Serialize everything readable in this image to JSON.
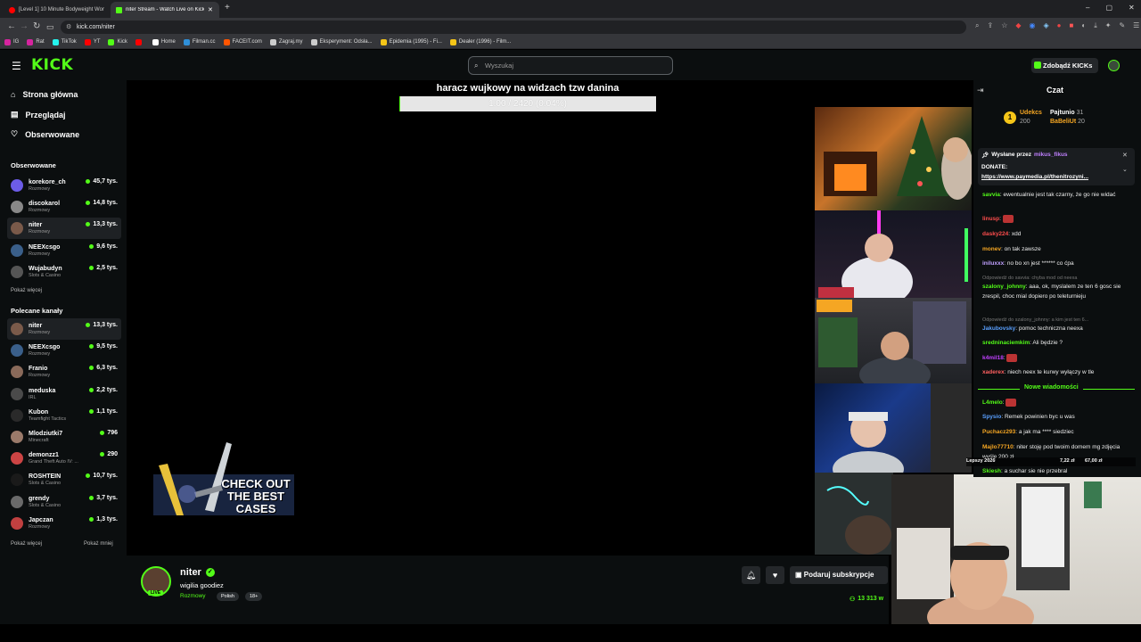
{
  "browser": {
    "tabs": [
      {
        "title": "[Level 1] 10 Minute Bodyweight Wor",
        "color": "#ff0000"
      },
      {
        "title": "niter Stream - Watch Live on Kick",
        "color": "#53fc18"
      }
    ],
    "new_tab": "+",
    "url": "kick.com/niter",
    "bookmarks": [
      {
        "label": "IG",
        "color": "#d6249f"
      },
      {
        "label": "Rat",
        "color": "#d6249f"
      },
      {
        "label": "TikTok",
        "color": "#25f4ee"
      },
      {
        "label": "YT",
        "color": "#ff0000"
      },
      {
        "label": "Kick",
        "color": "#53fc18"
      },
      {
        "label": "",
        "color": "#ff0000"
      },
      {
        "label": "Home",
        "color": "#ffffff"
      },
      {
        "label": "Filman.cc",
        "color": "#2f8fd8"
      },
      {
        "label": "FACEIT.com",
        "color": "#ff5500"
      },
      {
        "label": "Zagraj.my",
        "color": "#cccccc"
      },
      {
        "label": "Eksperyment: Odsła...",
        "color": "#cccccc"
      },
      {
        "label": "Epidemia (1995) - Fi...",
        "color": "#f5c518"
      },
      {
        "label": "Dealer (1996) - Film...",
        "color": "#f5c518"
      }
    ],
    "window_controls": [
      "–",
      "▢",
      "✕"
    ]
  },
  "header": {
    "logo": "KICK",
    "search_placeholder": "Wyszukaj",
    "kicks_button": "Zdobądź KICKs"
  },
  "sidebar": {
    "nav": [
      {
        "label": "Strona główna",
        "icon": "home-icon"
      },
      {
        "label": "Przeglądaj",
        "icon": "browse-icon"
      },
      {
        "label": "Obserwowane",
        "icon": "heart-icon"
      }
    ],
    "followed_title": "Obserwowane",
    "followed": [
      {
        "name": "korekore_ch",
        "category": "Rozmowy",
        "viewers": "45,7 tys.",
        "avatar": "#6c5ce7"
      },
      {
        "name": "discokarol",
        "category": "Rozmowy",
        "viewers": "14,8 tys.",
        "avatar": "#888888"
      },
      {
        "name": "niter",
        "category": "Rozmowy",
        "viewers": "13,3 tys.",
        "avatar": "#7a5a4a"
      },
      {
        "name": "NEEXcsgo",
        "category": "Rozmowy",
        "viewers": "9,6 tys.",
        "avatar": "#3a5f8a"
      },
      {
        "name": "Wujabudyn",
        "category": "Slots & Casino",
        "viewers": "2,5 tys.",
        "avatar": "#555555"
      }
    ],
    "show_more": "Pokaż więcej",
    "recommended_title": "Polecane kanały",
    "recommended": [
      {
        "name": "niter",
        "category": "Rozmowy",
        "viewers": "13,3 tys.",
        "avatar": "#7a5a4a"
      },
      {
        "name": "NEEXcsgo",
        "category": "Rozmowy",
        "viewers": "9,5 tys.",
        "avatar": "#3a5f8a"
      },
      {
        "name": "Franio",
        "category": "Rozmowy",
        "viewers": "6,3 tys.",
        "avatar": "#8a6a5a"
      },
      {
        "name": "meduska",
        "category": "IRL",
        "viewers": "2,2 tys.",
        "avatar": "#4a4a4a"
      },
      {
        "name": "Kubon",
        "category": "Teamfight Tactics",
        "viewers": "1,1 tys.",
        "avatar": "#2a2a2a"
      },
      {
        "name": "Mlodziutki7",
        "category": "Minecraft",
        "viewers": "796",
        "avatar": "#9a7a6a"
      },
      {
        "name": "demonzz1",
        "category": "Grand Theft Auto IV: ...",
        "viewers": "290",
        "avatar": "#cc4444"
      },
      {
        "name": "ROSHTEIN",
        "category": "Slots & Casino",
        "viewers": "10,7 tys.",
        "avatar": "#1a1a1a"
      },
      {
        "name": "grendy",
        "category": "Slots & Casino",
        "viewers": "3,7 tys.",
        "avatar": "#6a6a6a"
      },
      {
        "name": "Japczan",
        "category": "Rozmowy",
        "viewers": "1,3 tys.",
        "avatar": "#c04040"
      }
    ],
    "show_more2": "Pokaż więcej",
    "show_less": "Pokaż mniej"
  },
  "stream": {
    "overlay_title": "haracz wujkowy na widzach tzw danina",
    "goal_text": "1.00 / 2420 (0.04%)",
    "goal_progress": 0.0004,
    "promo": "CHECK OUT THE BEST CASES",
    "streamer": "niter",
    "stream_title": "wigilia goodiez",
    "category": "Rozmowy",
    "tags": [
      "Polish",
      "18+"
    ],
    "live_badge": "LIVE",
    "subscribe": "Podaruj subskrypcje",
    "viewers": "13 313 w"
  },
  "chat": {
    "title": "Czat",
    "top_gifters": [
      {
        "name": "Udekcs",
        "amount": "200",
        "color": "#f5a623"
      },
      {
        "name": "Pajtunio",
        "amount": "31",
        "color": "#ffffff"
      },
      {
        "name": "BaBeliUt",
        "amount": "20",
        "color": "#f5a623"
      }
    ],
    "pinned_by_label": "Wysłane przez",
    "pinned_user": "mikus_fikus",
    "pinned_text": "DONATE:",
    "pinned_link": "https://www.paymedia.pl/thenitrozyni...",
    "messages": [
      {
        "user": "savvia",
        "text": "ewentualnie jest tak czarny, że go nie widać",
        "color": "#53fc18"
      },
      {
        "user": "linusp",
        "text": "",
        "color": "#ff4d4d"
      },
      {
        "user": "dasky224",
        "text": "xdd",
        "color": "#ff4d4d"
      },
      {
        "user": "monev",
        "text": "on tak zawsze",
        "color": "#f5a623"
      },
      {
        "user": "iniluxxx",
        "text": "no bo xn jest ****** co ćpa",
        "color": "#c0a0ff"
      },
      {
        "reply": "Odpowiedź do savvia: chyba mod od neexa"
      },
      {
        "user": "szalony_johnny",
        "text": "aaa, ok, myslalem ze ten 6 gosc sie zrespil, choc mial dopiero po teleturnieju",
        "color": "#53fc18"
      },
      {
        "reply": "Odpowiedź do szalony_johnny: a kim jest ten 6..."
      },
      {
        "user": "Jakubovsky",
        "text": "pomoc techniczna neexa",
        "color": "#5aa0ff"
      },
      {
        "user": "sredninaciemkim",
        "text": "Ali będzie ?",
        "color": "#53fc18"
      },
      {
        "user": "k4mil18",
        "text": "",
        "color": "#c040ff"
      },
      {
        "user": "xaderex",
        "text": "niech neex te kurwy wyłączy w tle",
        "color": "#ff6060"
      }
    ],
    "new_messages": "Nowe wiadomości",
    "messages2": [
      {
        "user": "L4melo",
        "text": "",
        "color": "#53fc18"
      },
      {
        "user": "Spysio",
        "text": "Remek powinien byc u was",
        "color": "#5aa0ff"
      },
      {
        "user": "Puchacz293",
        "text": "a jak ma **** siedziec",
        "color": "#f5a623"
      },
      {
        "user": "Majlo77710",
        "text": "niter stoję pod twoim domem mg zdjęcia wyślę 200 zł",
        "color": "#f5a623"
      },
      {
        "user": "Skiesh",
        "text": "a suchar sie nie przebral",
        "color": "#53fc18"
      }
    ],
    "overlay_left": "Lepszy 2026",
    "overlay_mid": "7,22 zł",
    "overlay_right": "67,00 zł"
  }
}
